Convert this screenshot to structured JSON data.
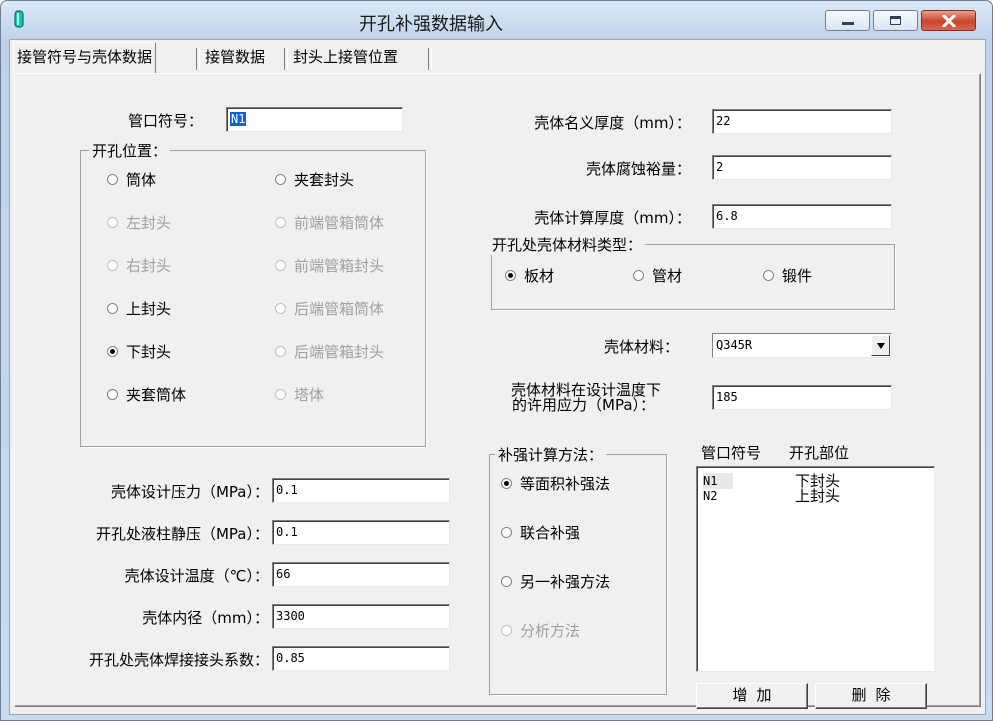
{
  "window": {
    "title": "开孔补强数据输入"
  },
  "tabs": [
    "接管符号与壳体数据",
    "接管数据",
    "封头上接管位置"
  ],
  "nozzle_symbol": {
    "label": "管口符号：",
    "value": "N1"
  },
  "opening_position": {
    "title": "开孔位置：",
    "options": [
      {
        "label": "筒体",
        "checked": false,
        "enabled": true
      },
      {
        "label": "夹套封头",
        "checked": false,
        "enabled": true
      },
      {
        "label": "左封头",
        "checked": false,
        "enabled": false
      },
      {
        "label": "前端管箱筒体",
        "checked": false,
        "enabled": false
      },
      {
        "label": "右封头",
        "checked": false,
        "enabled": false
      },
      {
        "label": "前端管箱封头",
        "checked": false,
        "enabled": false
      },
      {
        "label": "上封头",
        "checked": false,
        "enabled": true
      },
      {
        "label": "后端管箱筒体",
        "checked": false,
        "enabled": false
      },
      {
        "label": "下封头",
        "checked": true,
        "enabled": true
      },
      {
        "label": "后端管箱封头",
        "checked": false,
        "enabled": false
      },
      {
        "label": "夹套筒体",
        "checked": false,
        "enabled": true
      },
      {
        "label": "塔体",
        "checked": false,
        "enabled": false
      }
    ]
  },
  "left_fields": [
    {
      "label": "壳体设计压力（MPa）：",
      "value": "0.1"
    },
    {
      "label": "开孔处液柱静压（MPa）：",
      "value": "0.1"
    },
    {
      "label": "壳体设计温度（℃）：",
      "value": "66"
    },
    {
      "label": "壳体内径（mm）：",
      "value": "3300"
    },
    {
      "label": "开孔处壳体焊接接头系数：",
      "value": "0.85"
    }
  ],
  "right_fields": [
    {
      "label": "壳体名义厚度（mm）：",
      "value": "22"
    },
    {
      "label": "壳体腐蚀裕量：",
      "value": "2"
    },
    {
      "label": "壳体计算厚度（mm）：",
      "value": "6.8"
    }
  ],
  "material_type": {
    "title": "开孔处壳体材料类型：",
    "options": [
      {
        "label": "板材",
        "checked": true
      },
      {
        "label": "管材",
        "checked": false
      },
      {
        "label": "锻件",
        "checked": false
      }
    ]
  },
  "shell_material": {
    "label": "壳体材料：",
    "value": "Q345R"
  },
  "allowable_stress": {
    "label_line1": "壳体材料在设计温度下",
    "label_line2": "的许用应力（MPa）：",
    "value": "185"
  },
  "reinforcement_method": {
    "title": "补强计算方法：",
    "options": [
      {
        "label": "等面积补强法",
        "checked": true,
        "enabled": true
      },
      {
        "label": "联合补强",
        "checked": false,
        "enabled": true
      },
      {
        "label": "另一补强方法",
        "checked": false,
        "enabled": true
      },
      {
        "label": "分析方法",
        "checked": false,
        "enabled": false
      }
    ]
  },
  "nozzle_list": {
    "headers": [
      "管口符号",
      "开孔部位"
    ],
    "rows": [
      [
        "N1",
        "下封头"
      ],
      [
        "N2",
        "上封头"
      ]
    ]
  },
  "buttons": {
    "add": "增 加",
    "delete": "删 除"
  }
}
